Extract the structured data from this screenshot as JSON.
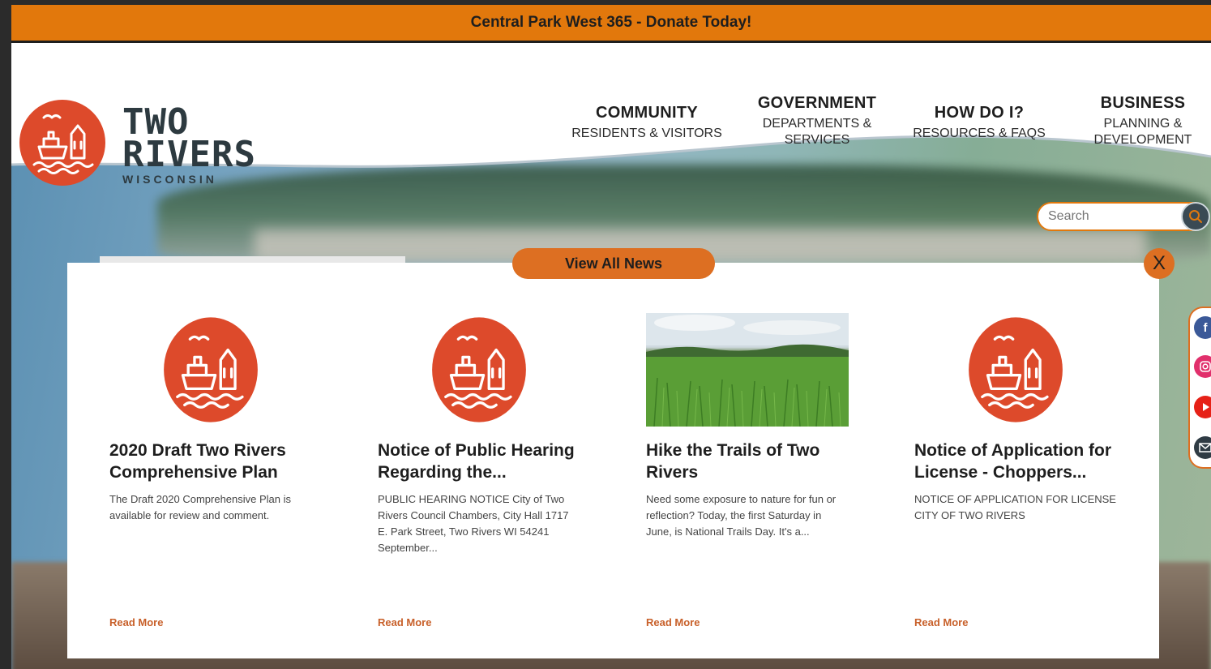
{
  "banner": {
    "text": "Central Park West 365 - Donate Today!"
  },
  "logo": {
    "line1": "TWO",
    "line2": "RIVERS",
    "line3": "WISCONSIN"
  },
  "nav": [
    {
      "title": "COMMUNITY",
      "sub1": "RESIDENTS & VISITORS",
      "sub2": ""
    },
    {
      "title": "GOVERNMENT",
      "sub1": "DEPARTMENTS &",
      "sub2": "SERVICES"
    },
    {
      "title": "HOW DO I?",
      "sub1": "RESOURCES & FAQS",
      "sub2": ""
    },
    {
      "title": "BUSINESS",
      "sub1": "PLANNING &",
      "sub2": "DEVELOPMENT"
    }
  ],
  "search": {
    "placeholder": "Search"
  },
  "news": {
    "view_all": "View All News",
    "close": "X",
    "items": [
      {
        "title": "2020 Draft Two Rivers Comprehensive Plan",
        "desc": "The Draft 2020 Comprehensive Plan is available  for review and comment.",
        "read_more": "Read More",
        "image": "logo"
      },
      {
        "title": "Notice of Public Hearing Regarding the...",
        "desc": "PUBLIC HEARING NOTICE City of Two Rivers Council Chambers, City Hall 1717 E. Park Street, Two Rivers WI 54241 September...",
        "read_more": "Read More",
        "image": "logo"
      },
      {
        "title": "Hike the Trails of Two Rivers",
        "desc": "Need some exposure to nature for fun or reflection? Today, the first Saturday in June, is National Trails Day. It's a...",
        "read_more": "Read More",
        "image": "field-photo"
      },
      {
        "title": "Notice of Application for License - Choppers...",
        "desc": "NOTICE OF APPLICATION FOR LICENSE CITY OF TWO RIVERS",
        "read_more": "Read More",
        "image": "logo"
      }
    ]
  },
  "social": [
    "facebook-icon",
    "instagram-icon",
    "youtube-icon",
    "email-icon"
  ],
  "colors": {
    "accent": "#e2780c",
    "button": "#dd6f22",
    "logo_red": "#dd4a2b",
    "read_more": "#c8602a"
  }
}
